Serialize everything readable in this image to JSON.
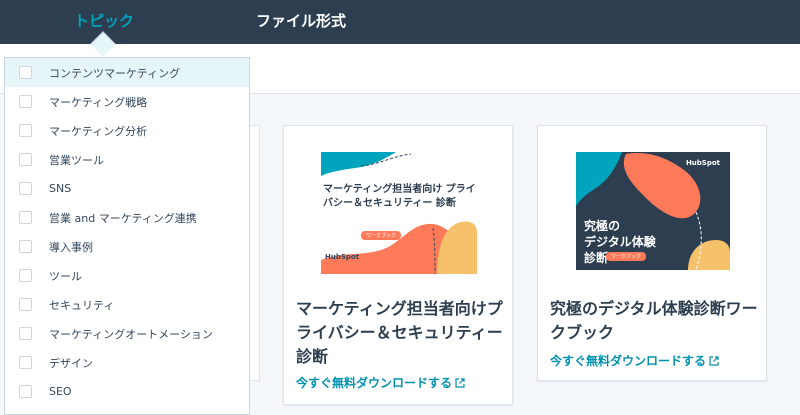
{
  "nav": {
    "tabs": [
      {
        "label": "トピック",
        "active": true
      },
      {
        "label": "ファイル形式",
        "active": false
      }
    ]
  },
  "dropdown": {
    "items": [
      {
        "label": "コンテンツマーケティング",
        "checked": false
      },
      {
        "label": "マーケティング戦略",
        "checked": false
      },
      {
        "label": "マーケティング分析",
        "checked": false
      },
      {
        "label": "営業ツール",
        "checked": false
      },
      {
        "label": "SNS",
        "checked": false
      },
      {
        "label": "営業 and マーケティング連携",
        "checked": false
      },
      {
        "label": "導入事例",
        "checked": false
      },
      {
        "label": "ツール",
        "checked": false
      },
      {
        "label": "セキュリティ",
        "checked": false
      },
      {
        "label": "マーケティングオートメーション",
        "checked": false
      },
      {
        "label": "デザイン",
        "checked": false
      },
      {
        "label": "SEO",
        "checked": false
      }
    ]
  },
  "cards": [
    {
      "thumb_title": "マーケティング担当者向け プライバシー＆セキュリティー 診断",
      "thumb_badge": "ワークブック",
      "thumb_logo": "HubSpot",
      "title": "マーケティング担当者向けプライバシー＆セキュリティー診断",
      "link": "今すぐ無料ダウンロードする"
    },
    {
      "thumb_title_1": "究極の",
      "thumb_title_2": "デジタル体験",
      "thumb_title_3": "診断",
      "thumb_badge": "ワークブック",
      "thumb_logo": "HubSpot",
      "title": "究極のデジタル体験診断ワークブック",
      "link": "今すぐ無料ダウンロードする"
    }
  ],
  "colors": {
    "navbar": "#2d3e50",
    "accent": "#00a4bd",
    "link": "#0091ae",
    "orange": "#ff7a59",
    "yellow": "#f5c26b",
    "teal": "#00a4bd"
  }
}
